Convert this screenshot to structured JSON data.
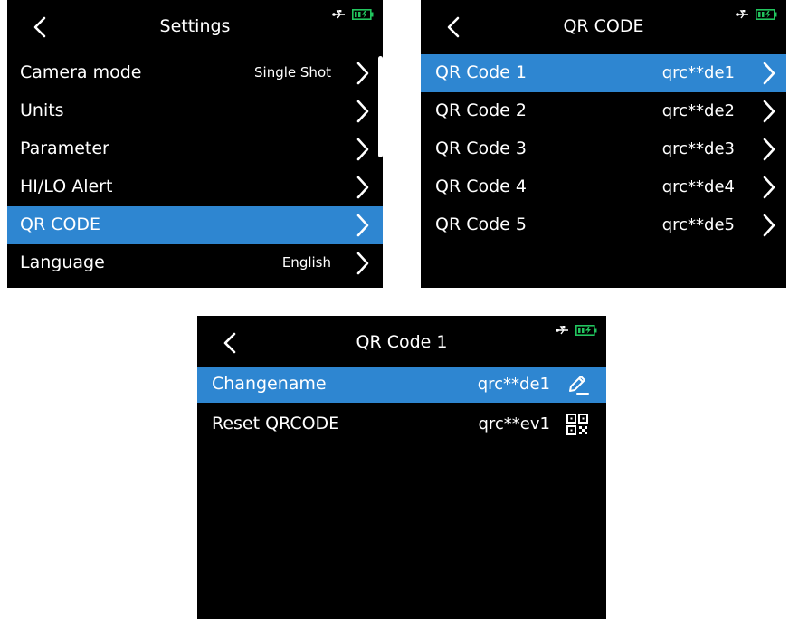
{
  "settings": {
    "title": "Settings",
    "items": [
      {
        "label": "Camera mode",
        "value": "Single Shot"
      },
      {
        "label": "Units",
        "value": ""
      },
      {
        "label": "Parameter",
        "value": ""
      },
      {
        "label": "HI/LO Alert",
        "value": ""
      },
      {
        "label": "QR CODE",
        "value": ""
      },
      {
        "label": "Language",
        "value": "English"
      }
    ],
    "selected_index": 4
  },
  "qr_list": {
    "title": "QR CODE",
    "items": [
      {
        "label": "QR Code 1",
        "value": "qrc**de1"
      },
      {
        "label": "QR Code 2",
        "value": "qrc**de2"
      },
      {
        "label": "QR Code 3",
        "value": "qrc**de3"
      },
      {
        "label": "QR Code 4",
        "value": "qrc**de4"
      },
      {
        "label": "QR Code 5",
        "value": "qrc**de5"
      }
    ],
    "selected_index": 0
  },
  "qr_detail": {
    "title": "QR Code 1",
    "items": [
      {
        "label": "Changename",
        "value": "qrc**de1",
        "icon": "pencil-icon"
      },
      {
        "label": "Reset QRCODE",
        "value": "qrc**ev1",
        "icon": "qr-code-icon"
      }
    ],
    "selected_index": 0
  },
  "colors": {
    "highlight": "#2e86d1",
    "battery": "#22c55e",
    "background": "#000000",
    "text": "#ffffff"
  }
}
